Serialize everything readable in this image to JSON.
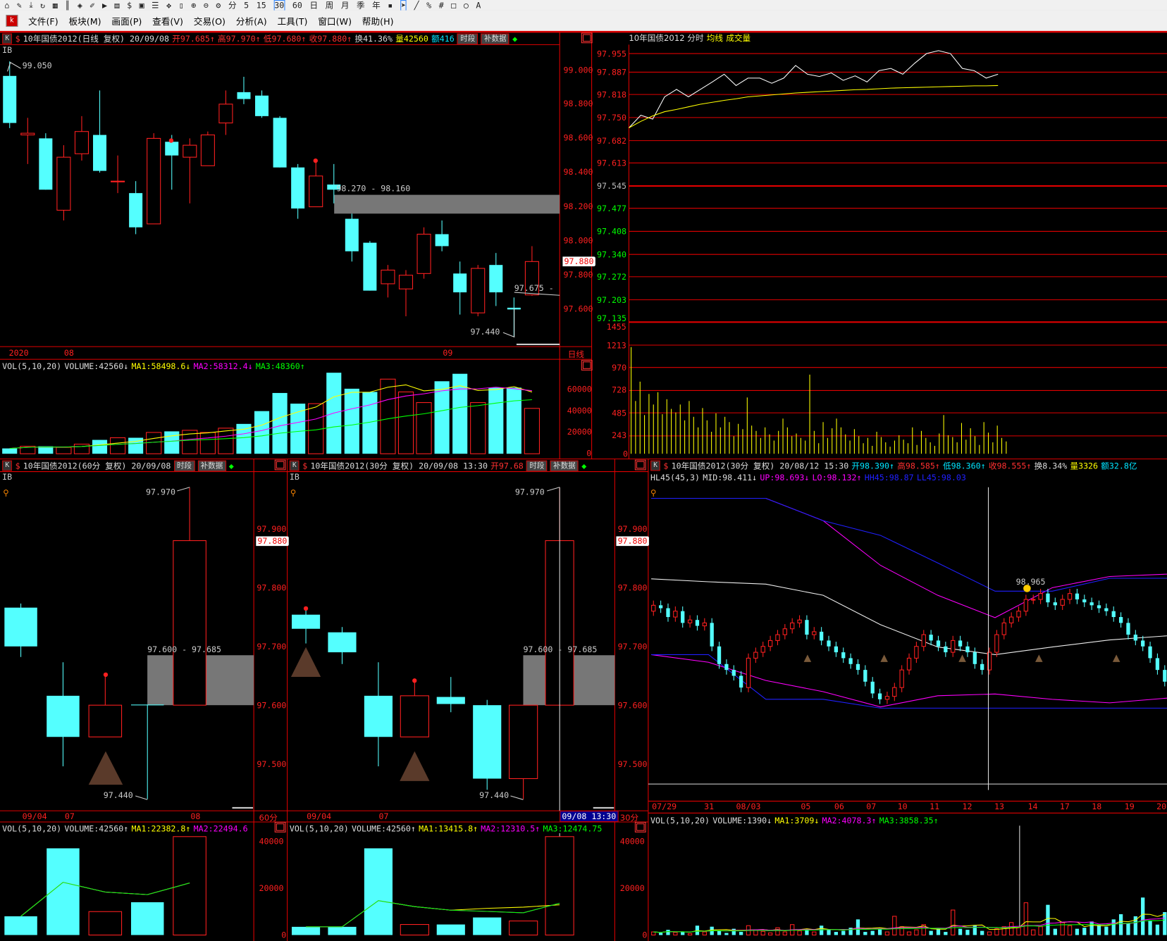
{
  "toolbar": {
    "icons": [
      "home-icon",
      "pencil-icon",
      "download-icon",
      "refresh-icon",
      "grid-icon",
      "bars-icon",
      "diamond-icon",
      "edit-icon",
      "play-icon",
      "doc-icon",
      "dollar-icon",
      "cube-icon",
      "list-icon",
      "move-icon",
      "lock-icon",
      "zoom-in-icon",
      "zoom-out-icon",
      "gear-icon"
    ],
    "periods": [
      "分",
      "5",
      "15",
      "30",
      "60",
      "日",
      "周",
      "月",
      "季",
      "年"
    ]
  },
  "menu": [
    "文件(F)",
    "板块(M)",
    "画面(P)",
    "查看(V)",
    "交易(O)",
    "分析(A)",
    "工具(T)",
    "窗口(W)",
    "帮助(H)"
  ],
  "colors": {
    "up": "#ff2020",
    "down": "#54ffff",
    "bg": "#000000",
    "grid": "#e00000",
    "ma1": "#ffff00",
    "ma2": "#ff00ff",
    "ma3": "#00ff00"
  },
  "daily": {
    "k": "K",
    "title": "10年国债2012(日线 复权) 20/09/08",
    "open": "开97.685↑",
    "high": "高97.970↑",
    "low": "低97.680↑",
    "close": "收97.880↑",
    "turnover": "换41.36%",
    "volume": "量42560",
    "amount": "额416",
    "btn_period": "时段",
    "btn_fill": "补数据",
    "ib": "IB",
    "axis": [
      "99.000",
      "98.800",
      "98.600",
      "98.400",
      "98.200",
      "98.000",
      "97.800",
      "97.600"
    ],
    "last_price": "97.880",
    "label_high": "99.050",
    "label_zone": "98.270 - 98.160",
    "label_mark": "97.675 -",
    "label_low": "97.440",
    "dates": [
      "2020",
      "08",
      "09"
    ],
    "period": "日线",
    "vol_title": "VOL(5,10,20)",
    "vol_volume": "VOLUME:42560↓",
    "vol_ma1": "MA1:58498.6↓",
    "vol_ma2": "MA2:58312.4↓",
    "vol_ma3": "MA3:48360↑",
    "vol_axis": [
      "60000",
      "40000",
      "20000",
      "0"
    ]
  },
  "intraday": {
    "title": "10年国债2012 分时",
    "avg": "均线",
    "vol": "成交量",
    "axis_up": [
      "97.955",
      "97.887",
      "97.818",
      "97.750",
      "97.682",
      "97.613"
    ],
    "axis_mid": "97.545",
    "axis_down": [
      "97.477",
      "97.408",
      "97.340",
      "97.272",
      "97.203",
      "97.135"
    ],
    "vol_axis": [
      "1455",
      "1213",
      "970",
      "728",
      "485",
      "243",
      "0"
    ]
  },
  "m60": {
    "k": "K",
    "title": "10年国债2012(60分 复权) 20/09/08",
    "btn_period": "时段",
    "btn_fill": "补数据",
    "ib": "IB",
    "axis": [
      "97.900",
      "97.800",
      "97.700",
      "97.600",
      "97.500"
    ],
    "last_price": "97.880",
    "label_high": "97.970",
    "label_zone": "97.600 - 97.685",
    "label_low": "97.440",
    "dates": [
      "09/04",
      "07",
      "08"
    ],
    "period": "60分",
    "vol_title": "VOL(5,10,20)",
    "vol_volume": "VOLUME:42560↑",
    "vol_ma1": "MA1:22382.8↑",
    "vol_ma2": "MA2:22494.6",
    "vol_axis": [
      "40000",
      "20000",
      "0"
    ]
  },
  "m30": {
    "k": "K",
    "title": "10年国债2012(30分 复权) 20/09/08 13:30",
    "open": "开97.68",
    "btn_period": "时段",
    "btn_fill": "补数据",
    "ib": "IB",
    "axis": [
      "97.900",
      "97.800",
      "97.700",
      "97.600",
      "97.500"
    ],
    "last_price": "97.880",
    "label_high": "97.970",
    "label_zone": "97.600 - 97.685",
    "label_low": "97.440",
    "dates": [
      "09/04",
      "07"
    ],
    "cursor_date": "09/08 13:30",
    "period": "30分",
    "vol_title": "VOL(5,10,20)",
    "vol_volume": "VOLUME:42560↑",
    "vol_ma1": "MA1:13415.8↑",
    "vol_ma2": "MA2:12310.5↑",
    "vol_ma3": "MA3:12474.75",
    "vol_axis": [
      "40000",
      "20000",
      "0"
    ]
  },
  "hl30": {
    "k": "K",
    "title": "10年国债2012(30分 复权) 20/08/12 15:30",
    "open": "开98.390↑",
    "high": "高98.585↑",
    "low": "低98.360↑",
    "close": "收98.555↑",
    "turnover": "换8.34%",
    "volume": "量3326",
    "amount": "额32.8亿",
    "ind_title": "HL45(45,3)",
    "mid": "MID:98.411↓",
    "up": "UP:98.693↓",
    "lo": "LO:98.132↑",
    "hh": "HH45:98.87",
    "ll": "LL45:98.03",
    "label_peak": "98.965",
    "dates": [
      "07/29",
      "31",
      "08/03",
      "05",
      "06",
      "07",
      "10",
      "11",
      "12",
      "13",
      "14",
      "17",
      "18",
      "19",
      "20"
    ],
    "vol_title": "VOL(5,10,20)",
    "vol_volume": "VOLUME:1390↓",
    "vol_ma1": "MA1:3709↓",
    "vol_ma2": "MA2:4078.3↑",
    "vol_ma3": "MA3:3858.35↑"
  },
  "chart_data": [
    {
      "type": "candlestick",
      "name": "daily",
      "ylim": [
        97.44,
        99.05
      ],
      "ohlc": [
        [
          98.965,
          99.05,
          98.66,
          98.69
        ],
        [
          98.62,
          98.72,
          98.45,
          98.63
        ],
        [
          98.6,
          98.63,
          98.3,
          98.3
        ],
        [
          98.18,
          98.56,
          98.12,
          98.49
        ],
        [
          98.51,
          98.73,
          98.47,
          98.64
        ],
        [
          98.62,
          98.88,
          98.4,
          98.41
        ],
        [
          98.35,
          98.5,
          98.28,
          98.35
        ],
        [
          98.28,
          98.35,
          98.04,
          98.08
        ],
        [
          98.1,
          98.63,
          98.1,
          98.6
        ],
        [
          98.58,
          98.62,
          98.3,
          98.5
        ],
        [
          98.49,
          98.6,
          98.22,
          98.56
        ],
        [
          98.44,
          98.64,
          98.44,
          98.62
        ],
        [
          98.69,
          98.88,
          98.62,
          98.8
        ],
        [
          98.87,
          98.96,
          98.8,
          98.83
        ],
        [
          98.85,
          98.88,
          98.72,
          98.73
        ],
        [
          98.72,
          98.73,
          98.43,
          98.43
        ],
        [
          98.43,
          98.45,
          98.13,
          98.19
        ],
        [
          98.2,
          98.47,
          98.2,
          98.38
        ],
        [
          98.33,
          98.45,
          98.22,
          98.3
        ],
        [
          98.13,
          98.16,
          97.88,
          97.94
        ],
        [
          97.99,
          98.0,
          97.71,
          97.71
        ],
        [
          97.75,
          97.86,
          97.67,
          97.83
        ],
        [
          97.72,
          97.83,
          97.56,
          97.8
        ],
        [
          97.81,
          98.08,
          97.78,
          98.04
        ],
        [
          98.04,
          98.12,
          97.94,
          97.97
        ],
        [
          97.81,
          97.88,
          97.57,
          97.7
        ],
        [
          97.58,
          97.86,
          97.56,
          97.84
        ],
        [
          97.86,
          97.93,
          97.62,
          97.7
        ],
        [
          97.61,
          97.67,
          97.44,
          97.6
        ],
        [
          97.685,
          97.97,
          97.68,
          97.88
        ]
      ],
      "volume": [
        5000,
        7000,
        7000,
        6000,
        9000,
        13000,
        15000,
        15000,
        20000,
        21000,
        22000,
        20000,
        24000,
        28000,
        40000,
        57000,
        47000,
        47000,
        76000,
        61000,
        58000,
        70000,
        58000,
        48000,
        68000,
        75000,
        48000,
        62000,
        62000,
        42560
      ],
      "zone": [
        98.16,
        98.27
      ]
    },
    {
      "type": "line",
      "name": "intraday",
      "ylim": [
        97.135,
        97.955
      ],
      "session_slots": 45,
      "price": [
        97.725,
        97.764,
        97.752,
        97.821,
        97.844,
        97.821,
        97.844,
        97.867,
        97.891,
        97.856,
        97.879,
        97.879,
        97.863,
        97.879,
        97.918,
        97.891,
        97.884,
        97.895,
        97.872,
        97.886,
        97.867,
        97.902,
        97.909,
        97.891,
        97.925,
        97.955,
        97.964,
        97.955,
        97.909,
        97.902,
        97.879,
        97.891
      ],
      "avg": [
        97.725,
        97.745,
        97.762,
        97.775,
        97.782,
        97.79,
        97.798,
        97.804,
        97.81,
        97.815,
        97.821,
        97.824,
        97.827,
        97.83,
        97.833,
        97.835,
        97.837,
        97.839,
        97.841,
        97.843,
        97.844,
        97.846,
        97.848,
        97.849,
        97.85,
        97.851,
        97.852,
        97.853,
        97.854,
        97.855,
        97.855,
        97.856
      ],
      "volume": [
        1213,
        600,
        820,
        440,
        680,
        560,
        700,
        450,
        620,
        510,
        470,
        560,
        380,
        600,
        420,
        300,
        520,
        380,
        250,
        460,
        300,
        420,
        360,
        200,
        340,
        280,
        640,
        320,
        260,
        180,
        300,
        220,
        150,
        260,
        400,
        300,
        200,
        230,
        180,
        150,
        900,
        260,
        120,
        360,
        180,
        290,
        400,
        300,
        220,
        150,
        280,
        200,
        120,
        180,
        90,
        250,
        190,
        130,
        80,
        150,
        210,
        160,
        120,
        300,
        100,
        260,
        180,
        130,
        90,
        230,
        440,
        210,
        190,
        130,
        350,
        160,
        290,
        200,
        100,
        360,
        240,
        130,
        320,
        180,
        140
      ]
    },
    {
      "type": "candlestick",
      "name": "60min",
      "ylim": [
        97.44,
        97.97
      ],
      "ohlc": [
        [
          97.766,
          97.773,
          97.682,
          97.7
        ],
        [
          97.616,
          97.673,
          97.496,
          97.546
        ],
        [
          97.546,
          97.652,
          97.546,
          97.6
        ],
        [
          97.601,
          97.601,
          97.44,
          97.6
        ],
        [
          97.6,
          97.97,
          97.6,
          97.88
        ]
      ],
      "volume": [
        8000,
        37000,
        10000,
        14000,
        42000
      ],
      "zone": [
        97.6,
        97.685
      ],
      "markers": [
        2
      ]
    },
    {
      "type": "candlestick",
      "name": "30min",
      "ylim": [
        97.44,
        97.97
      ],
      "ohlc": [
        [
          97.754,
          97.764,
          97.705,
          97.73
        ],
        [
          97.724,
          97.733,
          97.67,
          97.69
        ],
        [
          97.616,
          97.673,
          97.496,
          97.546
        ],
        [
          97.546,
          97.642,
          97.546,
          97.616
        ],
        [
          97.614,
          97.648,
          97.588,
          97.602
        ],
        [
          97.6,
          97.609,
          97.456,
          97.475
        ],
        [
          97.475,
          97.6,
          97.44,
          97.6
        ],
        [
          97.6,
          97.97,
          97.6,
          97.88
        ]
      ],
      "volume": [
        3500,
        3500,
        37000,
        4500,
        4500,
        7500,
        6000,
        42000
      ],
      "zone": [
        97.6,
        97.685
      ],
      "markers": [
        0,
        3
      ]
    },
    {
      "type": "candlestick",
      "name": "hl45-30min",
      "close": [
        97.77,
        97.765,
        97.75,
        97.76,
        97.74,
        97.745,
        97.735,
        97.74,
        97.7,
        97.67,
        97.66,
        97.65,
        97.63,
        97.68,
        97.69,
        97.7,
        97.71,
        97.72,
        97.73,
        97.74,
        97.745,
        97.72,
        97.725,
        97.71,
        97.7,
        97.69,
        97.68,
        97.67,
        97.66,
        97.64,
        97.62,
        97.61,
        97.615,
        97.63,
        97.66,
        97.68,
        97.7,
        97.72,
        97.71,
        97.7,
        97.69,
        97.71,
        97.7,
        97.69,
        97.67,
        97.66,
        97.69,
        97.72,
        97.74,
        97.75,
        97.76,
        97.78,
        97.78,
        97.79,
        97.775,
        97.77,
        97.78,
        97.79,
        97.78,
        97.775,
        97.77,
        97.765,
        97.76,
        97.75,
        97.74,
        97.72,
        97.71,
        97.7,
        97.68,
        97.66,
        97.64
      ],
      "up": [
        97.952,
        97.952,
        97.952,
        97.914,
        97.838,
        97.787,
        97.749,
        97.8,
        97.819,
        97.823
      ],
      "hh": [
        97.952,
        97.952,
        97.952,
        97.914,
        97.889,
        97.842,
        97.794,
        97.794,
        97.816,
        97.816
      ],
      "mid": [
        97.815,
        97.81,
        97.806,
        97.787,
        97.737,
        97.699,
        97.686,
        97.699,
        97.711,
        97.718
      ],
      "lo": [
        97.686,
        97.673,
        97.642,
        97.623,
        97.597,
        97.616,
        97.619,
        97.61,
        97.604,
        97.612
      ],
      "ll": [
        97.686,
        97.686,
        97.61,
        97.61,
        97.595,
        97.595,
        97.595,
        97.595,
        97.595,
        97.595
      ],
      "volume": [
        300,
        200,
        500,
        250,
        300,
        150,
        900,
        300,
        800,
        400,
        200,
        600,
        300,
        900,
        500,
        350,
        200,
        700,
        300,
        1000,
        400,
        600,
        300,
        900,
        500,
        300,
        400,
        700,
        1500,
        300,
        400,
        600,
        300,
        1800,
        800,
        300,
        500,
        1000,
        400,
        600,
        300,
        2400,
        600,
        500,
        900,
        400,
        300,
        600,
        800,
        1200,
        700,
        3100,
        500,
        800,
        2900,
        600,
        1200,
        900,
        600,
        700,
        1300,
        1000,
        800,
        1500,
        2000,
        1100,
        1800,
        3600,
        1400,
        1000,
        2200
      ]
    }
  ]
}
